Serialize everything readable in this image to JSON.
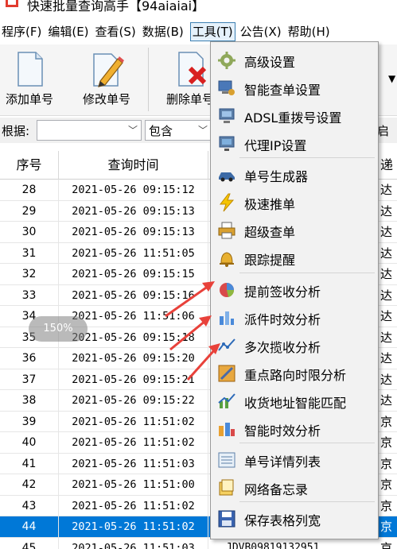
{
  "window": {
    "title": "快速批量查询高手【94aiaiai】"
  },
  "menubar": {
    "items": [
      {
        "label": "程序(F)"
      },
      {
        "label": "编辑(E)"
      },
      {
        "label": "查看(S)"
      },
      {
        "label": "数据(B)"
      },
      {
        "label": "工具(T)",
        "active": true
      },
      {
        "label": "公告(X)"
      },
      {
        "label": "帮助(H)"
      }
    ]
  },
  "toolbar": {
    "buttons": [
      {
        "label": "添加单号",
        "icon": "document-icon"
      },
      {
        "label": "修改单号",
        "icon": "edit-pencil-icon"
      },
      {
        "label": "删除单号",
        "icon": "delete-document-icon"
      }
    ]
  },
  "filter": {
    "label": "根据:",
    "field_value": "",
    "condition_value": "包含",
    "right_text": "启"
  },
  "grid": {
    "columns": [
      "序号",
      "查询时间",
      "",
      "递"
    ],
    "rows": [
      {
        "seq": "28",
        "time": "2021-05-26 09:15:12",
        "carrier": "达"
      },
      {
        "seq": "29",
        "time": "2021-05-26 09:15:13",
        "carrier": "达"
      },
      {
        "seq": "30",
        "time": "2021-05-26 09:15:13",
        "carrier": "达"
      },
      {
        "seq": "31",
        "time": "2021-05-26 11:51:05",
        "carrier": "达"
      },
      {
        "seq": "32",
        "time": "2021-05-26 09:15:15",
        "carrier": "达"
      },
      {
        "seq": "33",
        "time": "2021-05-26 09:15:16",
        "carrier": "达"
      },
      {
        "seq": "34",
        "time": "2021-05-26 11:51:06",
        "carrier": "达"
      },
      {
        "seq": "35",
        "time": "2021-05-26 09:15:18",
        "carrier": "达"
      },
      {
        "seq": "36",
        "time": "2021-05-26 09:15:20",
        "carrier": "达"
      },
      {
        "seq": "37",
        "time": "2021-05-26 09:15:21",
        "carrier": "达"
      },
      {
        "seq": "38",
        "time": "2021-05-26 09:15:22",
        "carrier": "达"
      },
      {
        "seq": "39",
        "time": "2021-05-26 11:51:02",
        "carrier": "京"
      },
      {
        "seq": "40",
        "time": "2021-05-26 11:51:02",
        "carrier": "京"
      },
      {
        "seq": "41",
        "time": "2021-05-26 11:51:03",
        "carrier": "京"
      },
      {
        "seq": "42",
        "time": "2021-05-26 11:51:00",
        "carrier": "京"
      },
      {
        "seq": "43",
        "time": "2021-05-26 11:51:02",
        "carrier": "京"
      },
      {
        "seq": "44",
        "time": "2021-05-26 11:51:02",
        "carrier": "京",
        "selected": true
      },
      {
        "seq": "45",
        "time": "2021-05-26 11:51:03",
        "track": "JDVB09819132951",
        "carrier": "京"
      }
    ]
  },
  "zoom_indicator": "150%",
  "tools_menu": {
    "items": [
      {
        "label": "高级设置",
        "icon": "gear-icon"
      },
      {
        "label": "智能查单设置",
        "icon": "computer-settings-icon"
      },
      {
        "label": "ADSL重拨号设置",
        "icon": "network-icon"
      },
      {
        "label": "代理IP设置",
        "icon": "proxy-server-icon"
      },
      {
        "label": "单号生成器",
        "icon": "car-icon"
      },
      {
        "label": "极速推单",
        "icon": "lightning-icon"
      },
      {
        "label": "超级查单",
        "icon": "printer-icon"
      },
      {
        "label": "跟踪提醒",
        "icon": "bell-icon"
      },
      {
        "label": "提前签收分析",
        "icon": "pie-chart-icon"
      },
      {
        "label": "派件时效分析",
        "icon": "bar-chart-icon"
      },
      {
        "label": "多次揽收分析",
        "icon": "line-chart-icon"
      },
      {
        "label": "重点路向时限分析",
        "icon": "route-analysis-icon"
      },
      {
        "label": "收货地址智能匹配",
        "icon": "trend-chart-icon"
      },
      {
        "label": "智能时效分析",
        "icon": "smart-analysis-icon"
      },
      {
        "label": "单号详情列表",
        "icon": "list-icon"
      },
      {
        "label": "网络备忘录",
        "icon": "memo-icon"
      },
      {
        "label": "保存表格列宽",
        "icon": "save-icon"
      }
    ]
  },
  "colors": {
    "selection": "#0078d7",
    "menu_bg": "#f2f2f2",
    "arrow": "#e8413a"
  }
}
